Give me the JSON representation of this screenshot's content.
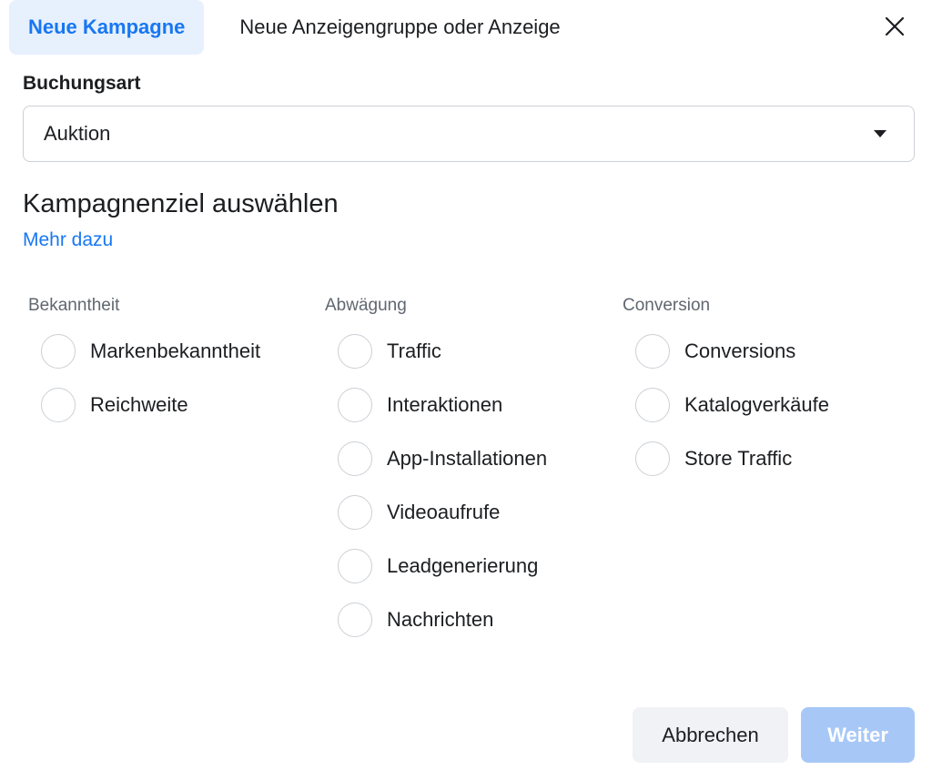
{
  "tabs": {
    "new_campaign": "Neue Kampagne",
    "new_adset_or_ad": "Neue Anzeigengruppe oder Anzeige"
  },
  "buying_type": {
    "label": "Buchungsart",
    "value": "Auktion"
  },
  "objective": {
    "title": "Kampagnenziel auswählen",
    "learn_more": "Mehr dazu"
  },
  "columns": [
    {
      "heading": "Bekanntheit",
      "options": [
        "Markenbekanntheit",
        "Reichweite"
      ]
    },
    {
      "heading": "Abwägung",
      "options": [
        "Traffic",
        "Interaktionen",
        "App-Installationen",
        "Videoaufrufe",
        "Leadgenerierung",
        "Nachrichten"
      ]
    },
    {
      "heading": "Conversion",
      "options": [
        "Conversions",
        "Katalogverkäufe",
        "Store Traffic"
      ]
    }
  ],
  "footer": {
    "cancel_label": "Abbrechen",
    "next_label": "Weiter"
  },
  "colors": {
    "accent": "#1877f2",
    "active_tab_bg": "#e7f0fd",
    "disabled_primary": "#a7c8f7",
    "secondary_button_bg": "#f0f2f5"
  },
  "icons": {
    "close": "close-icon",
    "dropdown": "caret-down-icon"
  }
}
